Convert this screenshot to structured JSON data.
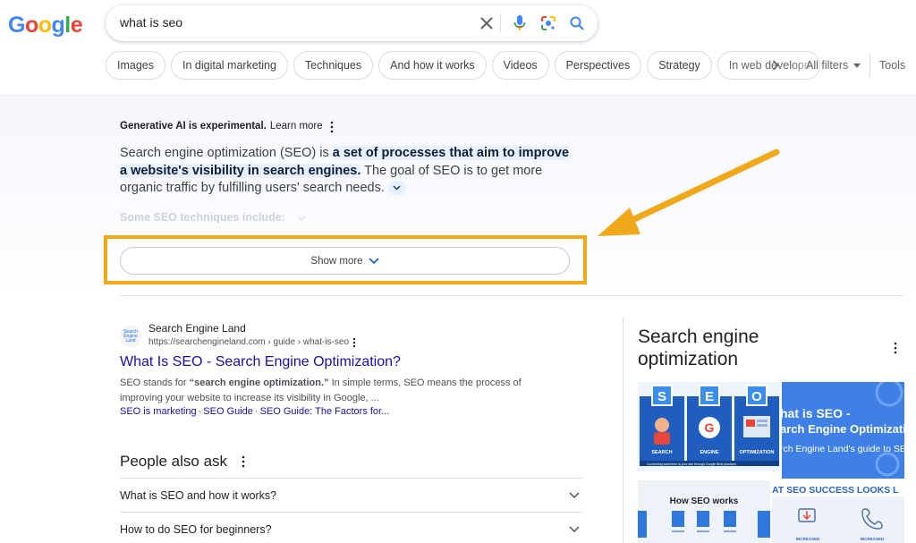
{
  "logo": {
    "letters": [
      "G",
      "o",
      "o",
      "g",
      "l",
      "e"
    ],
    "colors": [
      "#4285f4",
      "#ea4335",
      "#fbbc05",
      "#4285f4",
      "#34a853",
      "#ea4335"
    ]
  },
  "search": {
    "query": "what is seo"
  },
  "chips": [
    "Images",
    "In digital marketing",
    "Techniques",
    "And how it works",
    "Videos",
    "Perspectives",
    "Strategy",
    "In web development"
  ],
  "filters": {
    "all_filters": "All filters",
    "tools": "Tools"
  },
  "ai": {
    "label": "Generative AI is experimental.",
    "learn_more": "Learn more",
    "text_prefix": "Search engine optimization (SEO) is ",
    "text_highlight": "a set of processes that aim to improve a website's visibility in search engines.",
    "text_suffix": " The goal of SEO is to get more organic traffic by fulfilling users' search needs.",
    "faded": "Some SEO techniques include:",
    "show_more": "Show more"
  },
  "annotation": {
    "highlight_color": "#f0a91a"
  },
  "result": {
    "favicon_text": "Search Engine Land",
    "site": "Search Engine Land",
    "url": "https://searchengineland.com › guide › what-is-seo",
    "title": "What Is SEO - Search Engine Optimization?",
    "snippet_prefix": "SEO stands for ",
    "snippet_bold": "“search engine optimization.”",
    "snippet_suffix": " In simple terms, SEO means the process of improving your website to increase its visibility in Google, ...",
    "sitelinks": [
      "SEO is marketing",
      "SEO Guide",
      "SEO Guide: The Factors for..."
    ]
  },
  "paa": {
    "title": "People also ask",
    "questions": [
      "What is SEO and how it works?",
      "How to do SEO for beginners?"
    ]
  },
  "knowledge_panel": {
    "title": "Search engine optimization",
    "img1": {
      "letters": [
        "S",
        "E",
        "O"
      ],
      "captions": [
        "SEARCH",
        "ENGINE",
        "OPTIMIZATION"
      ],
      "footer": "Connecting searchers to your site through Google Best practices"
    },
    "img2": {
      "lines": [
        "hat is SEO -",
        "arch Engine Optimization",
        "rch Engine Land's guide to SEO"
      ]
    },
    "img3": {
      "title": "How SEO works"
    },
    "img4": {
      "title": "AT SEO SUCCESS LOOKS L",
      "labels": [
        "INCREASED",
        "INCREASED"
      ]
    }
  }
}
